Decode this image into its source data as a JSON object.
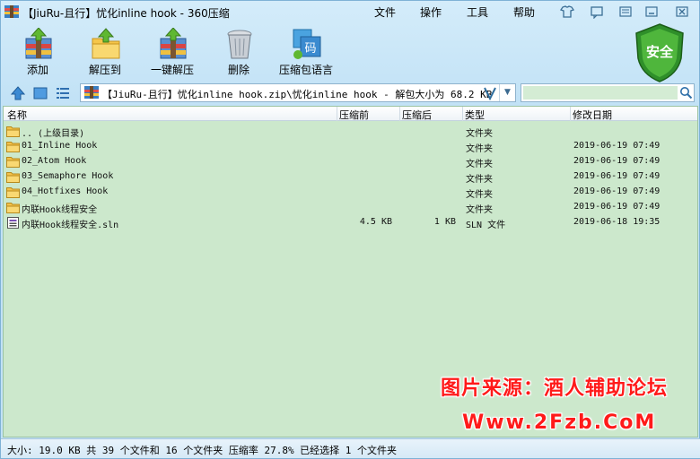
{
  "window": {
    "title": "【JiuRu-且行】忧化inline hook - 360压缩"
  },
  "menu": [
    "文件",
    "操作",
    "工具",
    "帮助"
  ],
  "toolbar": {
    "add_label": "添加",
    "extract_label": "解压到",
    "one_click_label": "一键解压",
    "delete_label": "删除",
    "language_label": "压缩包语言",
    "security_label": "安全"
  },
  "address": {
    "path": "【JiuRu-且行】忧化inline hook.zip\\忧化inline hook - 解包大小为 68.2 KB",
    "search_placeholder": ""
  },
  "columns": {
    "name": "名称",
    "packed": "压缩前",
    "size": "压缩后",
    "type": "类型",
    "date": "修改日期"
  },
  "rows": [
    {
      "name": ".. (上级目录)",
      "packed": "",
      "size": "",
      "type": "文件夹",
      "date": "",
      "icon": "folder-icon"
    },
    {
      "name": "01_Inline Hook",
      "packed": "",
      "size": "",
      "type": "文件夹",
      "date": "2019-06-19 07:49",
      "icon": "folder-icon"
    },
    {
      "name": "02_Atom Hook",
      "packed": "",
      "size": "",
      "type": "文件夹",
      "date": "2019-06-19 07:49",
      "icon": "folder-icon"
    },
    {
      "name": "03_Semaphore Hook",
      "packed": "",
      "size": "",
      "type": "文件夹",
      "date": "2019-06-19 07:49",
      "icon": "folder-icon"
    },
    {
      "name": "04_Hotfixes Hook",
      "packed": "",
      "size": "",
      "type": "文件夹",
      "date": "2019-06-19 07:49",
      "icon": "folder-icon"
    },
    {
      "name": "内联Hook线程安全",
      "packed": "",
      "size": "",
      "type": "文件夹",
      "date": "2019-06-19 07:49",
      "icon": "folder-icon"
    },
    {
      "name": "内联Hook线程安全.sln",
      "packed": "4.5 KB",
      "size": "1 KB",
      "type": "SLN 文件",
      "date": "2019-06-18 19:35",
      "icon": "sln-file-icon"
    }
  ],
  "watermark": {
    "line1": "图片来源：酒人辅助论坛",
    "line2": "Www.2Fzb.CoM"
  },
  "status": {
    "text": "大小: 19.0 KB 共 39 个文件和 16 个文件夹 压缩率 27.8% 已经选择 1 个文件夹"
  },
  "colors": {
    "list_bg": "#cce8cc",
    "chrome_bg": "#c2e2f6",
    "watermark": "#ff1a1a"
  }
}
